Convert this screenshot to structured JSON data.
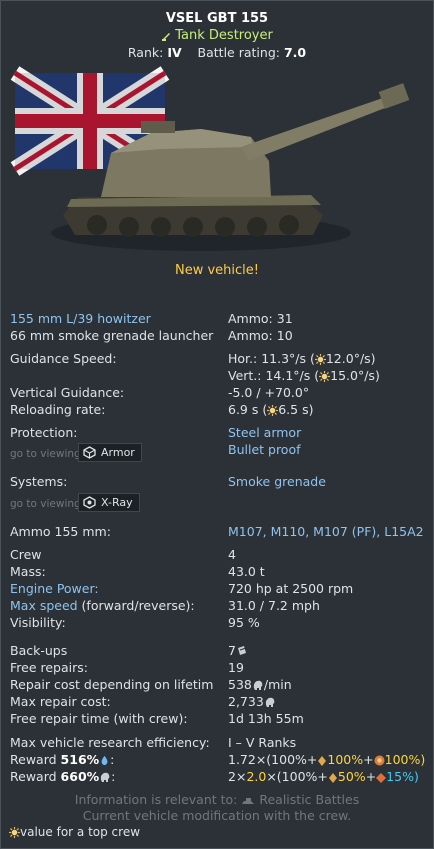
{
  "header": {
    "title": "VSEL GBT 155",
    "vehicle_class": "Tank Destroyer",
    "rank_label": "Rank:",
    "rank_value": "IV",
    "br_label": "Battle rating:",
    "br_value": "7.0"
  },
  "new_vehicle": "New vehicle!",
  "weapons": {
    "main_name": "155 mm L/39 howitzer",
    "main_ammo": "Ammo:  31",
    "secondary_name": "66 mm smoke grenade launcher",
    "secondary_ammo": "Ammo:  10"
  },
  "guidance": {
    "speed_label": "Guidance Speed:",
    "hor_prefix": "Hor.: 11.3°/s (",
    "hor_top": "12.0°/s)",
    "vert_prefix": "Vert.: 14.1°/s (",
    "vert_top": "15.0°/s)",
    "vertical_label": "Vertical Guidance:",
    "vertical_value": "-5.0 / +70.0°",
    "reload_label": "Reloading rate:",
    "reload_prefix": "6.9 s (",
    "reload_top": "6.5 s)"
  },
  "protection": {
    "label": "Protection:",
    "goto": "go to viewing",
    "button": "Armor",
    "items": [
      "Steel armor",
      "Bullet proof"
    ]
  },
  "systems": {
    "label": "Systems:",
    "goto": "go to viewing",
    "button": "X-Ray",
    "item": "Smoke grenade"
  },
  "ammo155": {
    "label": "Ammo 155 mm:",
    "value": "M107, M110, M107 (PF), L15A2"
  },
  "specs": [
    {
      "label": "Crew",
      "value": "4",
      "label_blue": false
    },
    {
      "label": "Mass:",
      "value": "43.0 t",
      "label_blue": false
    },
    {
      "label": "Engine Power:",
      "value": "720 hp at 2500 rpm",
      "label_blue": true
    },
    {
      "label": "Max speed",
      "label_suffix": " (forward/reverse):",
      "value": "31.0 / 7.2 mph",
      "label_blue": true
    },
    {
      "label": "Visibility:",
      "value": "95 %",
      "label_blue": false
    }
  ],
  "economy": {
    "backups_label": "Back-ups",
    "backups_value": "7",
    "free_repairs_label": "Free repairs:",
    "free_repairs_value": "19",
    "repair_cost_label": "Repair cost depending on lifetim",
    "repair_cost_value": "538",
    "repair_cost_unit": "/min",
    "max_repair_label": "Max repair cost:",
    "max_repair_value": "2,733",
    "free_time_label": "Free repair time (with crew):",
    "free_time_value": "1d 13h 55m"
  },
  "research": {
    "label": "Max vehicle research efficiency:",
    "value": "I – V Ranks",
    "reward1_label": "Reward",
    "reward1_pct": "516%",
    "reward1_a": "1.72×(100%+",
    "reward1_b": "100%",
    "reward1_c": "+",
    "reward1_d": "100%)",
    "reward2_label": "Reward",
    "reward2_pct": "660%",
    "reward2_a": "2×",
    "reward2_b": "2.0",
    "reward2_c": "×(100%+",
    "reward2_d": "50%",
    "reward2_e": "+",
    "reward2_f": "15%)"
  },
  "footer": {
    "line1_prefix": "Information is relevant to:",
    "line1_mode": "Realistic Battles",
    "line2": "Current vehicle modification with the crew.",
    "note": "value for a top crew"
  },
  "colors": {
    "background": "#2b3137",
    "accent_blue": "#8fc3ee",
    "vehicle_class": "#c6ef7a",
    "gold": "#ffd43a",
    "cyan": "#46c9f0"
  },
  "icons": [
    "tank-destroyer-icon",
    "top-crew-icon",
    "armor-icon",
    "xray-icon",
    "backup-icon",
    "silver-lions-icon",
    "research-points-icon",
    "golden-eagles-icon",
    "silver-lions-bonus-icon",
    "premium-bonus-icon",
    "realistic-battles-icon"
  ]
}
